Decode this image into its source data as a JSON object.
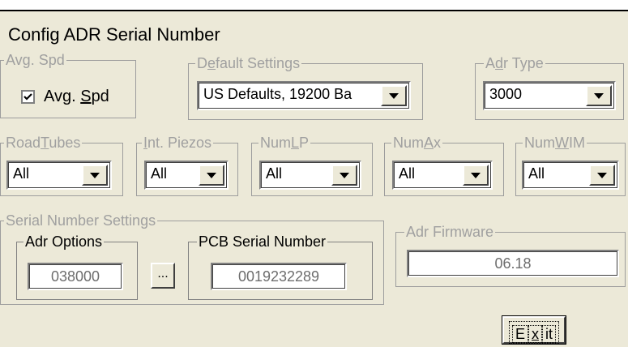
{
  "window": {
    "title": "Config ADR Serial Number"
  },
  "avg_spd_group": {
    "legend": "Avg. Spd",
    "checkbox": {
      "label_pre": "Avg. ",
      "label_u": "S",
      "label_post": "pd",
      "checked": true
    }
  },
  "default_settings": {
    "legend_pre": "D",
    "legend_u": "e",
    "legend_post": "fault Settings",
    "value": "US Defaults, 19200 Ba"
  },
  "adr_type": {
    "legend_pre": "A",
    "legend_u": "d",
    "legend_post": "r Type",
    "value": "3000"
  },
  "road_tubes": {
    "legend_pre": "Road",
    "legend_u": "T",
    "legend_post": "ubes",
    "value": "All"
  },
  "int_piezos": {
    "legend_pre": "",
    "legend_u": "I",
    "legend_post": "nt. Piezos",
    "value": "All"
  },
  "num_lp": {
    "legend_pre": "Num",
    "legend_u": "L",
    "legend_post": "P",
    "value": "All"
  },
  "num_ax": {
    "legend_pre": "Num",
    "legend_u": "A",
    "legend_post": "x",
    "value": "All"
  },
  "num_wim": {
    "legend_pre": "Num",
    "legend_u": "W",
    "legend_post": "IM",
    "value": "All"
  },
  "serial_settings": {
    "legend": "Serial Number Settings",
    "adr_options": {
      "legend": "Adr Options",
      "value": "038000"
    },
    "browse_label": "...",
    "pcb_serial": {
      "legend": "PCB Serial Number",
      "value": "0019232289"
    }
  },
  "adr_firmware": {
    "legend": "Adr Firmware",
    "value": "06.18"
  },
  "exit_button": {
    "label_pre": "E",
    "label_u": "x",
    "label_post": "it"
  }
}
